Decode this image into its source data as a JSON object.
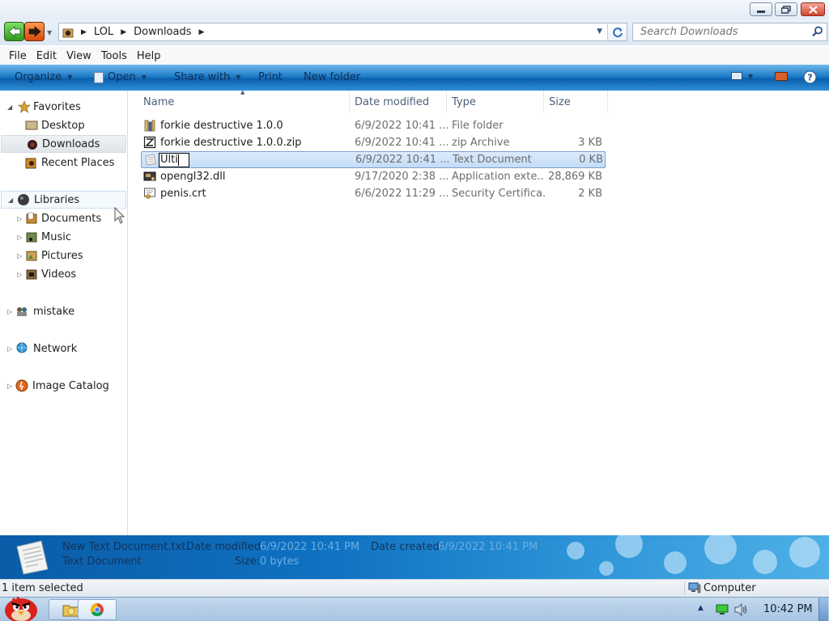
{
  "window": {
    "minimize_icon": "minimize-icon",
    "maximize_icon": "maximize-icon",
    "close_icon": "close-icon"
  },
  "address": {
    "crumbs": [
      "LOL",
      "Downloads"
    ],
    "search_placeholder": "Search Downloads"
  },
  "menu": [
    "File",
    "Edit",
    "View",
    "Tools",
    "Help"
  ],
  "toolbar": {
    "organize": "Organize",
    "open": "Open",
    "share_with": "Share with",
    "print": "Print",
    "new_folder": "New folder"
  },
  "nav": {
    "favorites": "Favorites",
    "desktop": "Desktop",
    "downloads": "Downloads",
    "recent_places": "Recent Places",
    "libraries": "Libraries",
    "documents": "Documents",
    "music": "Music",
    "pictures": "Pictures",
    "videos": "Videos",
    "mistake": "mistake",
    "network": "Network",
    "image_catalog": "Image Catalog"
  },
  "columns": {
    "name": "Name",
    "date_modified": "Date modified",
    "type": "Type",
    "size": "Size"
  },
  "files": [
    {
      "name": "forkie destructive 1.0.0",
      "date": "6/9/2022 10:41 ...",
      "type": "File folder",
      "size": "",
      "icon": "folder-icon"
    },
    {
      "name": "forkie destructive 1.0.0.zip",
      "date": "6/9/2022 10:41 ...",
      "type": "zip Archive",
      "size": "3 KB",
      "icon": "zip-icon"
    },
    {
      "name": "Ulti",
      "date": "6/9/2022 10:41 ...",
      "type": "Text Document",
      "size": "0 KB",
      "icon": "text-document-icon"
    },
    {
      "name": "opengl32.dll",
      "date": "9/17/2020 2:38 ...",
      "type": "Application exte...",
      "size": "28,869 KB",
      "icon": "dll-icon"
    },
    {
      "name": "penis.crt",
      "date": "6/6/2022 11:29 ...",
      "type": "Security Certifica...",
      "size": "2 KB",
      "icon": "certificate-icon"
    }
  ],
  "details": {
    "filename": "New Text Document.txt",
    "filetype": "Text Document",
    "date_modified_label": "Date modified:",
    "date_modified_value": "6/9/2022 10:41 PM",
    "date_created_label": "Date created:",
    "date_created_value": "6/9/2022 10:41 PM",
    "size_label": "Size:",
    "size_value": "0 bytes"
  },
  "status": {
    "selection": "1 item selected",
    "location": "Computer"
  },
  "taskbar": {
    "clock": "10:42 PM"
  }
}
